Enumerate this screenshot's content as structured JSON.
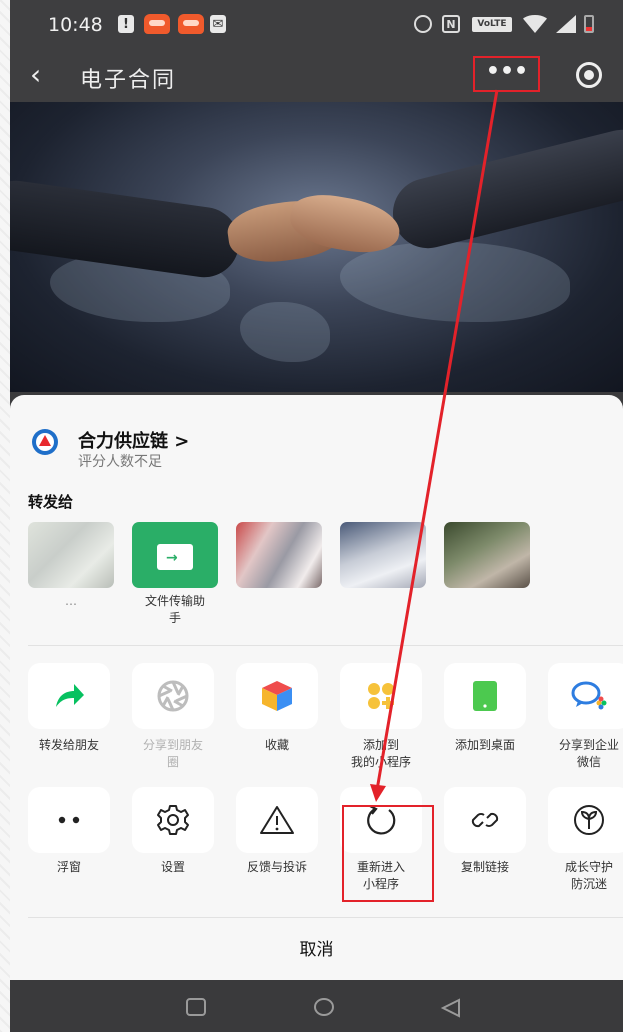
{
  "status": {
    "time": "10:48",
    "volte": "VoLTE",
    "nfc": "N",
    "notif": "!"
  },
  "nav": {
    "back_icon": "chevron-left-icon",
    "title": "电子合同",
    "more_label": "•••",
    "close_icon": "target-close-icon"
  },
  "miniapp": {
    "name": "合力供应链 >",
    "rating": "评分人数不足"
  },
  "share": {
    "title": "转发给",
    "contacts": [
      {
        "label_line1": "…",
        "label_line2": ""
      },
      {
        "label_line1": "文件传输助",
        "label_line2": "手"
      },
      {
        "label_line1": "",
        "label_line2": ""
      },
      {
        "label_line1": "",
        "label_line2": ""
      },
      {
        "label_line1": "",
        "label_line2": ""
      }
    ]
  },
  "actions_row1": [
    {
      "line1": "转发给朋友",
      "line2": "",
      "icon": "share-arrow-icon"
    },
    {
      "line1": "分享到朋友",
      "line2": "圈",
      "icon": "moments-shutter-icon",
      "disabled": true
    },
    {
      "line1": "收藏",
      "line2": "",
      "icon": "favorite-cube-icon"
    },
    {
      "line1": "添加到",
      "line2": "我的小程序",
      "icon": "my-miniprogram-icon"
    },
    {
      "line1": "添加到桌面",
      "line2": "",
      "icon": "add-desktop-icon"
    },
    {
      "line1": "分享到企业",
      "line2": "微信",
      "icon": "wecom-icon"
    }
  ],
  "actions_row2": [
    {
      "line1": "浮窗",
      "line2": "",
      "icon": "float-window-icon"
    },
    {
      "line1": "设置",
      "line2": "",
      "icon": "gear-icon"
    },
    {
      "line1": "反馈与投诉",
      "line2": "",
      "icon": "warning-icon"
    },
    {
      "line1": "重新进入",
      "line2": "小程序",
      "icon": "reload-icon"
    },
    {
      "line1": "复制链接",
      "line2": "",
      "icon": "link-icon"
    },
    {
      "line1": "成长守护",
      "line2": "防沉迷",
      "icon": "sprout-icon"
    }
  ],
  "cancel": "取消",
  "colors": {
    "accent_red": "#e3222a",
    "wechat_green": "#07c160",
    "miniapp_yellow": "#f6c23a"
  }
}
